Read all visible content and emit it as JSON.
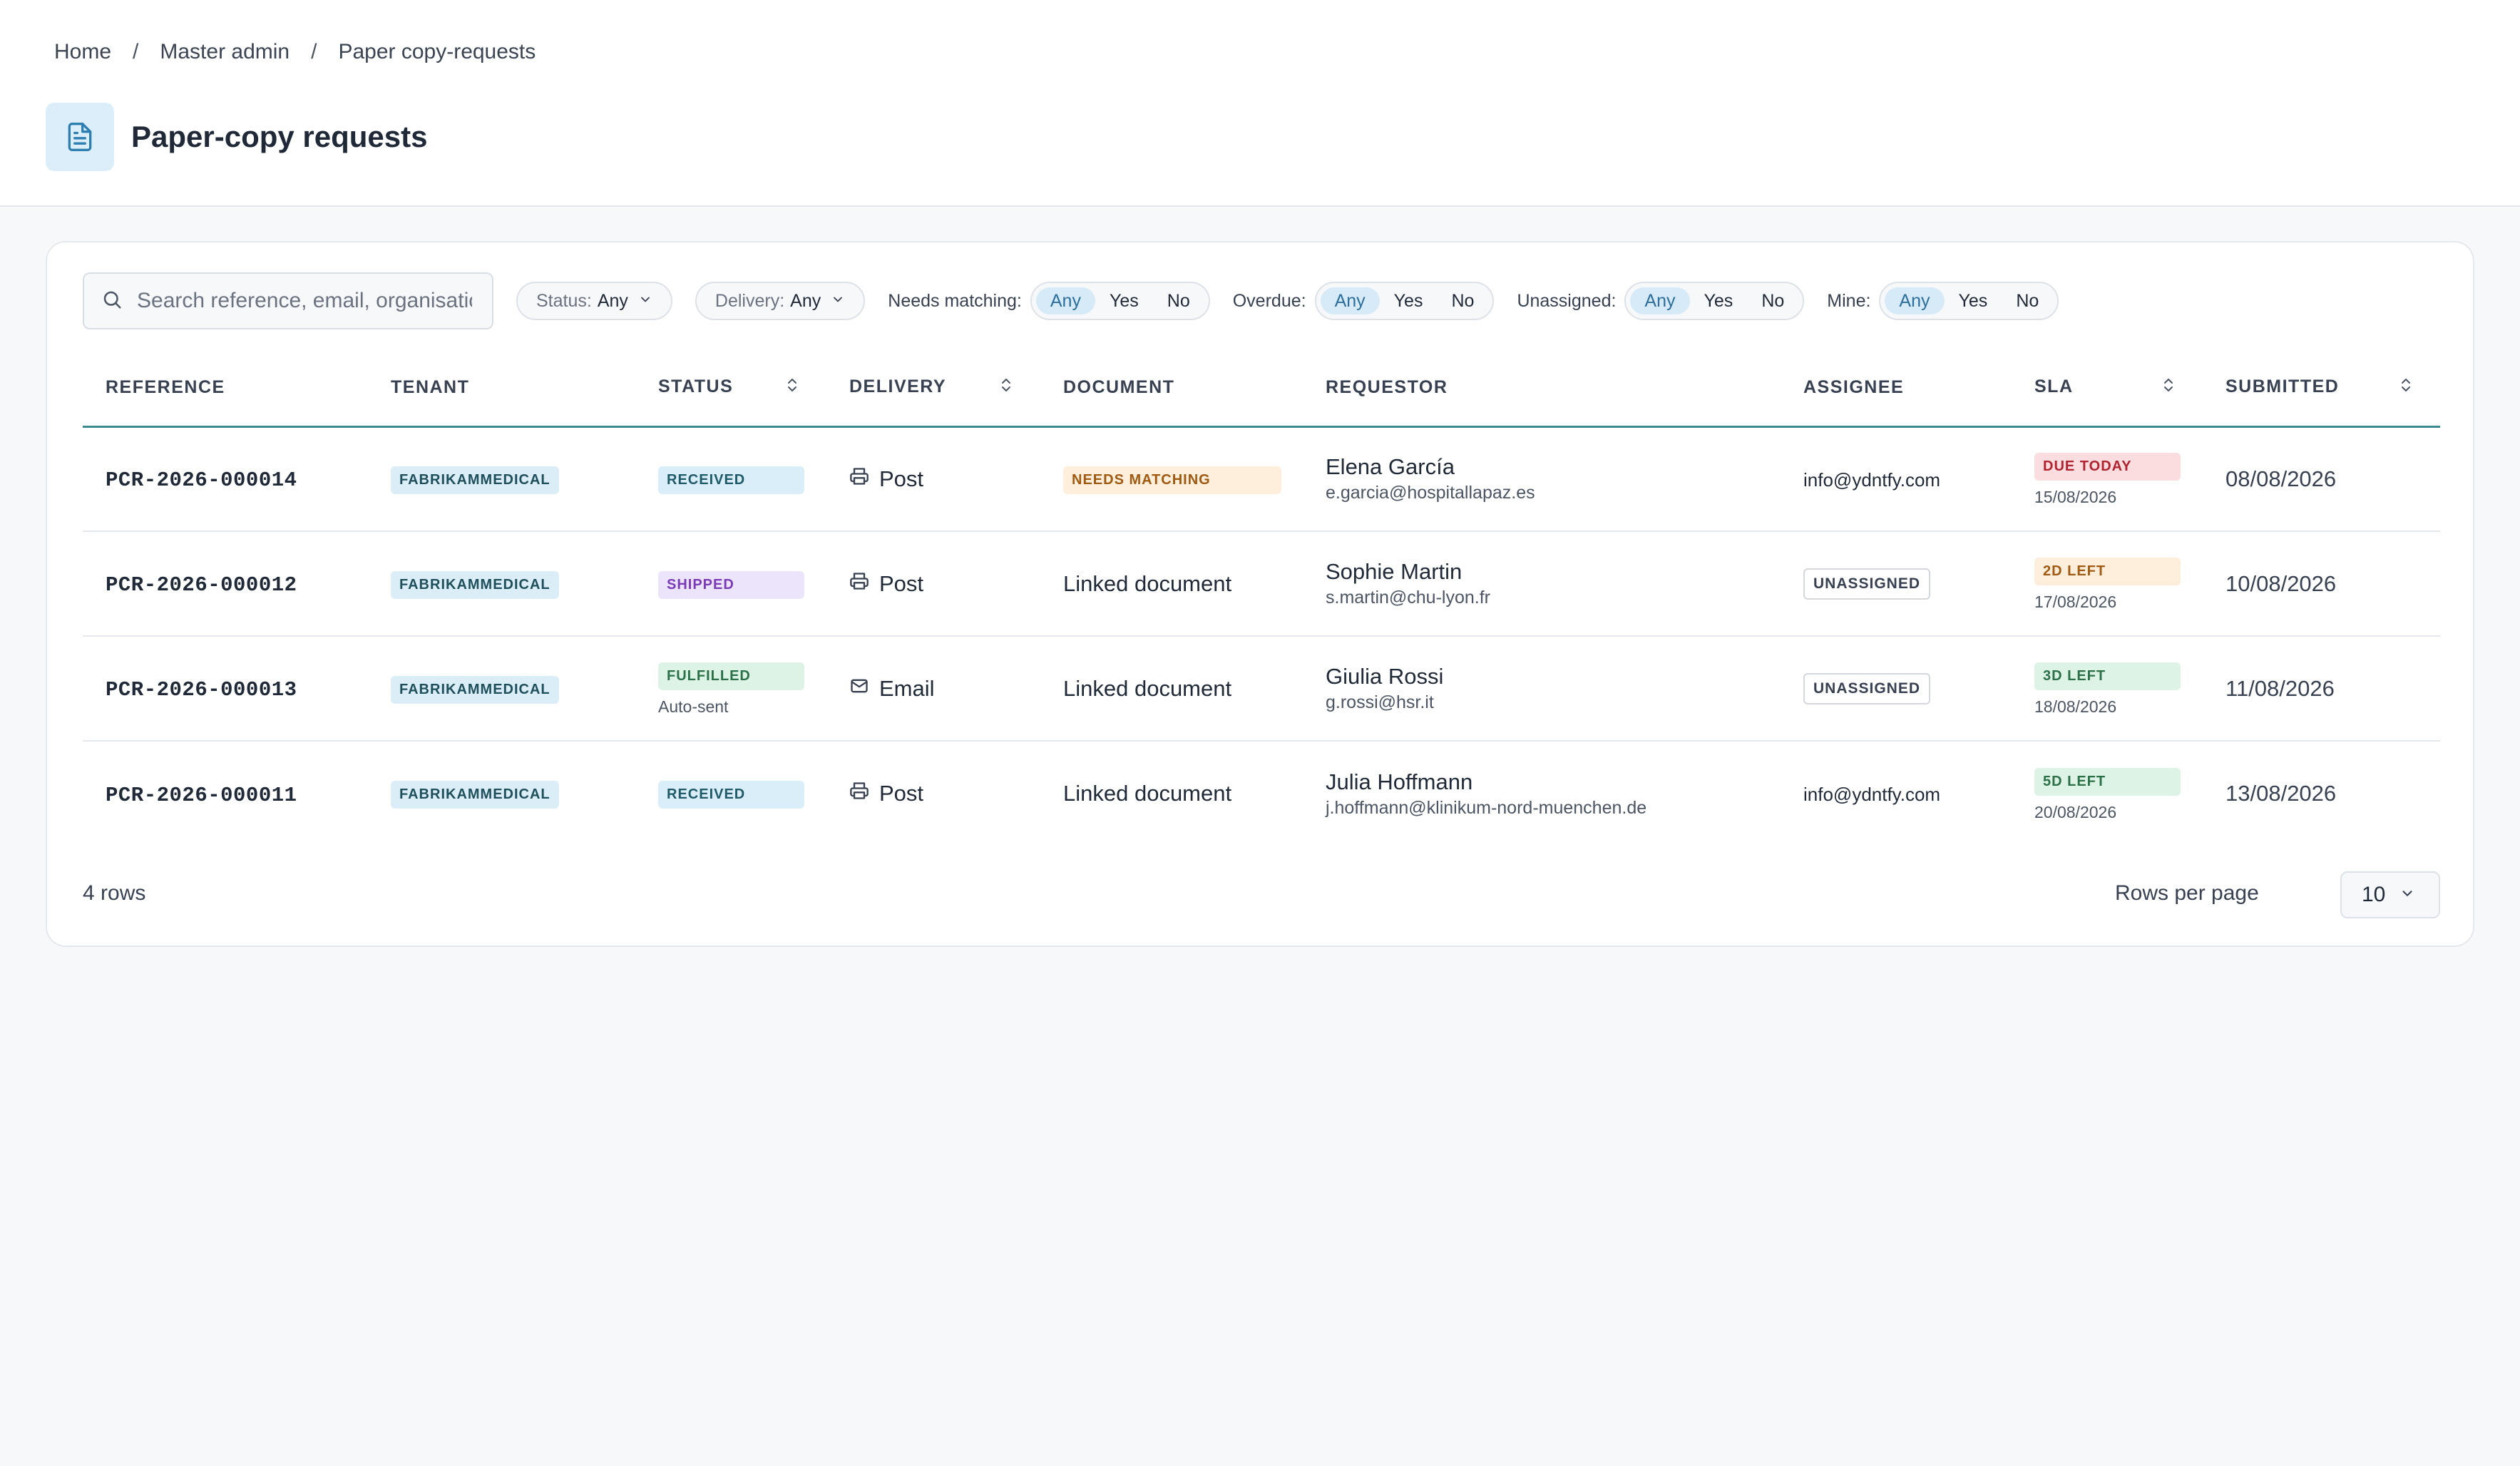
{
  "breadcrumb": {
    "items": [
      "Home",
      "Master admin",
      "Paper copy-requests"
    ],
    "separator": "/"
  },
  "page": {
    "title": "Paper-copy requests",
    "icon": "document-icon",
    "accent_color": "#2c6f9c"
  },
  "filters": {
    "search_placeholder": "Search reference, email, organisation",
    "status": {
      "label": "Status:",
      "value": "Any"
    },
    "delivery": {
      "label": "Delivery:",
      "value": "Any"
    },
    "needs_matching": {
      "label": "Needs matching:",
      "options": [
        "Any",
        "Yes",
        "No"
      ],
      "selected": "Any"
    },
    "overdue": {
      "label": "Overdue:",
      "options": [
        "Any",
        "Yes",
        "No"
      ],
      "selected": "Any"
    },
    "unassigned": {
      "label": "Unassigned:",
      "options": [
        "Any",
        "Yes",
        "No"
      ],
      "selected": "Any"
    },
    "mine": {
      "label": "Mine:",
      "options": [
        "Any",
        "Yes",
        "No"
      ],
      "selected": "Any"
    }
  },
  "table": {
    "columns": [
      "REFERENCE",
      "TENANT",
      "STATUS",
      "DELIVERY",
      "DOCUMENT",
      "REQUESTOR",
      "ASSIGNEE",
      "SLA",
      "SUBMITTED"
    ],
    "rows": [
      {
        "reference": "PCR-2026-000014",
        "tenant": "FABRIKAMMEDICAL",
        "status": "RECEIVED",
        "status_note": "",
        "delivery": "Post",
        "document": "NEEDS MATCHING",
        "requestor_name": "Elena García",
        "requestor_email": "e.garcia@hospitallapaz.es",
        "assignee": "info@ydntfy.com",
        "sla": "DUE TODAY",
        "sla_date": "15/08/2026",
        "submitted": "08/08/2026"
      },
      {
        "reference": "PCR-2026-000012",
        "tenant": "FABRIKAMMEDICAL",
        "status": "SHIPPED",
        "status_note": "",
        "delivery": "Post",
        "document": "Linked document",
        "requestor_name": "Sophie Martin",
        "requestor_email": "s.martin@chu-lyon.fr",
        "assignee": "UNASSIGNED",
        "sla": "2D LEFT",
        "sla_date": "17/08/2026",
        "submitted": "10/08/2026"
      },
      {
        "reference": "PCR-2026-000013",
        "tenant": "FABRIKAMMEDICAL",
        "status": "FULFILLED",
        "status_note": "Auto-sent",
        "delivery": "Email",
        "document": "Linked document",
        "requestor_name": "Giulia Rossi",
        "requestor_email": "g.rossi@hsr.it",
        "assignee": "UNASSIGNED",
        "sla": "3D LEFT",
        "sla_date": "18/08/2026",
        "submitted": "11/08/2026"
      },
      {
        "reference": "PCR-2026-000011",
        "tenant": "FABRIKAMMEDICAL",
        "status": "RECEIVED",
        "status_note": "",
        "delivery": "Post",
        "document": "Linked document",
        "requestor_name": "Julia Hoffmann",
        "requestor_email": "j.hoffmann@klinikum-nord-muenchen.de",
        "assignee": "info@ydntfy.com",
        "sla": "5D LEFT",
        "sla_date": "20/08/2026",
        "submitted": "13/08/2026"
      }
    ]
  },
  "footer": {
    "row_count": "4 rows",
    "rows_per_page_label": "Rows per page",
    "rows_per_page_value": "10"
  }
}
